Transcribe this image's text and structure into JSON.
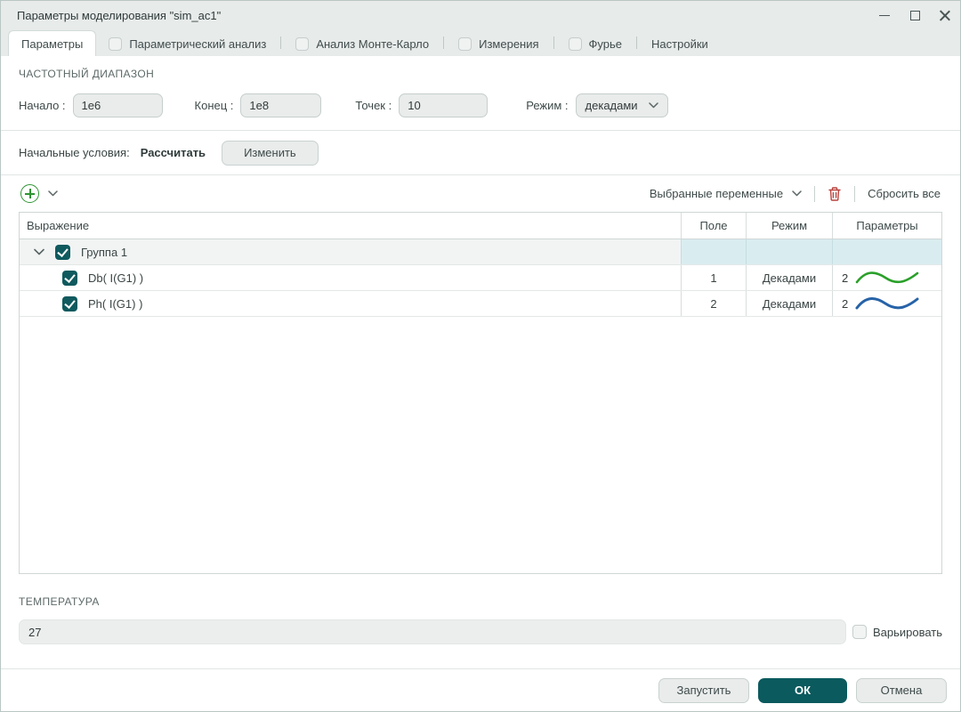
{
  "window": {
    "title": "Параметры моделирования \"sim_ac1\""
  },
  "tabs": [
    {
      "label": "Параметры",
      "has_checkbox": false,
      "active": true
    },
    {
      "label": "Параметрический анализ",
      "has_checkbox": true,
      "checked": false
    },
    {
      "label": "Анализ Монте-Карло",
      "has_checkbox": true,
      "checked": false
    },
    {
      "label": "Измерения",
      "has_checkbox": true,
      "checked": false
    },
    {
      "label": "Фурье",
      "has_checkbox": true,
      "checked": false
    },
    {
      "label": "Настройки",
      "has_checkbox": false,
      "active": false
    }
  ],
  "frequency_range": {
    "title": "ЧАСТОТНЫЙ ДИАПАЗОН",
    "start_label": "Начало :",
    "start_value": "1e6",
    "end_label": "Конец :",
    "end_value": "1e8",
    "points_label": "Точек :",
    "points_value": "10",
    "mode_label": "Режим :",
    "mode_value": "декадами"
  },
  "initial_conditions": {
    "label": "Начальные условия:",
    "mode_value": "Рассчитать",
    "edit_button": "Изменить"
  },
  "variables_toolbar": {
    "selected_label": "Выбранные переменные",
    "reset_label": "Сбросить все"
  },
  "table": {
    "headers": [
      "Выражение",
      "Поле",
      "Режим",
      "Параметры"
    ],
    "group": {
      "label": "Группа 1",
      "checked": true
    },
    "rows": [
      {
        "expression": "Db( I(G1) )",
        "checked": true,
        "field": "1",
        "mode": "Декадами",
        "thickness": "2",
        "wave_color": "#2aa02a"
      },
      {
        "expression": "Ph( I(G1) )",
        "checked": true,
        "field": "2",
        "mode": "Декадами",
        "thickness": "2",
        "wave_color": "#2763a8"
      }
    ]
  },
  "temperature": {
    "title": "ТЕМПЕРАТУРА",
    "value": "27",
    "vary_label": "Варьировать",
    "vary_checked": false
  },
  "footer": {
    "run": "Запустить",
    "ok": "ОК",
    "cancel": "Отмена"
  },
  "colors": {
    "accent_teal": "#0b5a5e",
    "add_green": "#2e9432",
    "delete_red": "#b8443e",
    "group_highlight": "#d9edf0"
  }
}
